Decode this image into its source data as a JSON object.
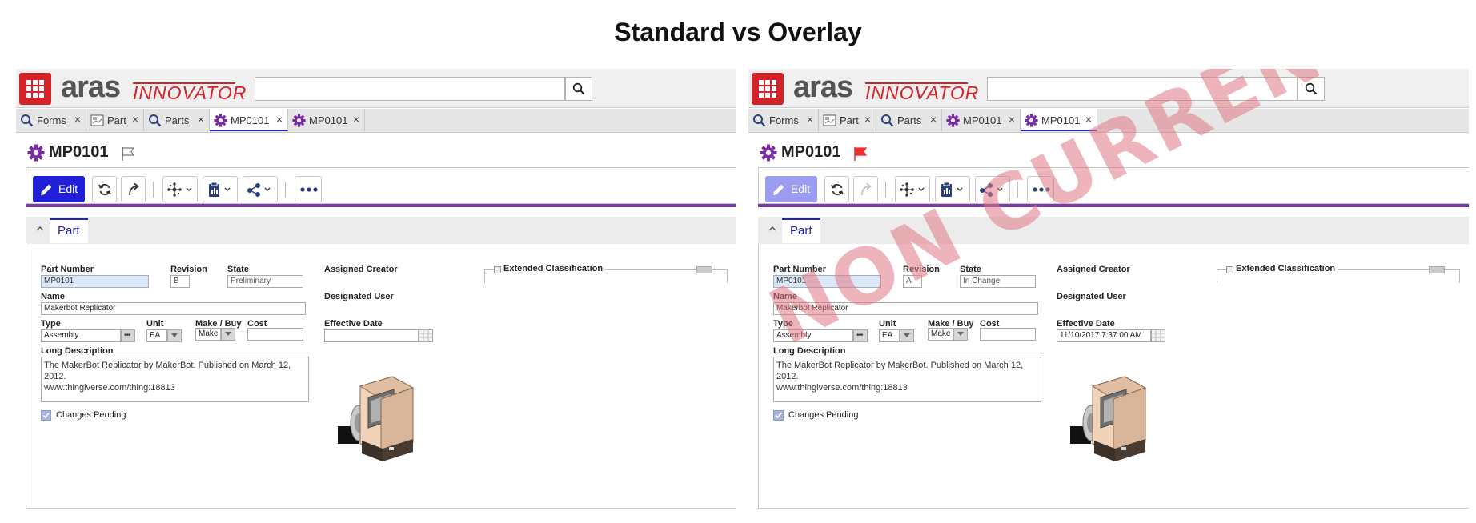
{
  "page_title": "Standard vs Overlay",
  "brand": {
    "aras": "aras",
    "innovator": "INNOVATOR",
    "accent": "#d32228"
  },
  "tabs": [
    {
      "label": "Forms",
      "icon": "search-icon",
      "close": "×"
    },
    {
      "label": "Part",
      "icon": "form-icon",
      "close": "×"
    },
    {
      "label": "Parts",
      "icon": "search-icon",
      "close": "×"
    },
    {
      "label": "MP0101",
      "icon": "gear-icon",
      "close": "×"
    },
    {
      "label": "MP0101",
      "icon": "gear-icon",
      "close": "×"
    }
  ],
  "panels": {
    "left": {
      "active_tab": 3,
      "item_title": "MP0101",
      "flag_color": "#888888",
      "edit_enabled": true,
      "edit_label": "Edit",
      "section_tab": "Part",
      "labels": {
        "part_number": "Part Number",
        "revision": "Revision",
        "state": "State",
        "assigned_creator": "Assigned Creator",
        "designated_user": "Designated User",
        "name": "Name",
        "type": "Type",
        "unit": "Unit",
        "make_buy": "Make / Buy",
        "cost": "Cost",
        "effective_date": "Effective Date",
        "long_description": "Long Description",
        "changes_pending": "Changes Pending",
        "extended_classification": "Extended Classification"
      },
      "values": {
        "part_number": "MP0101",
        "revision": "B",
        "state": "Preliminary",
        "name": "Makerbot Replicator",
        "type": "Assembly",
        "unit": "EA",
        "make_buy": "Make",
        "cost": "",
        "effective_date": "",
        "long_description": "The MakerBot Replicator by MakerBot. Published on March 12, 2012.\nwww.thingiverse.com/thing:18813"
      },
      "watermark": ""
    },
    "right": {
      "active_tab": 4,
      "item_title": "MP0101",
      "flag_color": "#e8312f",
      "edit_enabled": false,
      "edit_label": "Edit",
      "section_tab": "Part",
      "labels": {
        "part_number": "Part Number",
        "revision": "Revision",
        "state": "State",
        "assigned_creator": "Assigned Creator",
        "designated_user": "Designated User",
        "name": "Name",
        "type": "Type",
        "unit": "Unit",
        "make_buy": "Make / Buy",
        "cost": "Cost",
        "effective_date": "Effective Date",
        "long_description": "Long Description",
        "changes_pending": "Changes Pending",
        "extended_classification": "Extended Classification"
      },
      "values": {
        "part_number": "MP0101",
        "revision": "A",
        "state": "In Change",
        "name": "Makerbot Replicator",
        "type": "Assembly",
        "unit": "EA",
        "make_buy": "Make",
        "cost": "",
        "effective_date": "11/10/2017 7:37:00 AM",
        "long_description": "The MakerBot Replicator by MakerBot. Published on March 12, 2012.\nwww.thingiverse.com/thing:18813"
      },
      "watermark": "NON CURRENT"
    }
  }
}
